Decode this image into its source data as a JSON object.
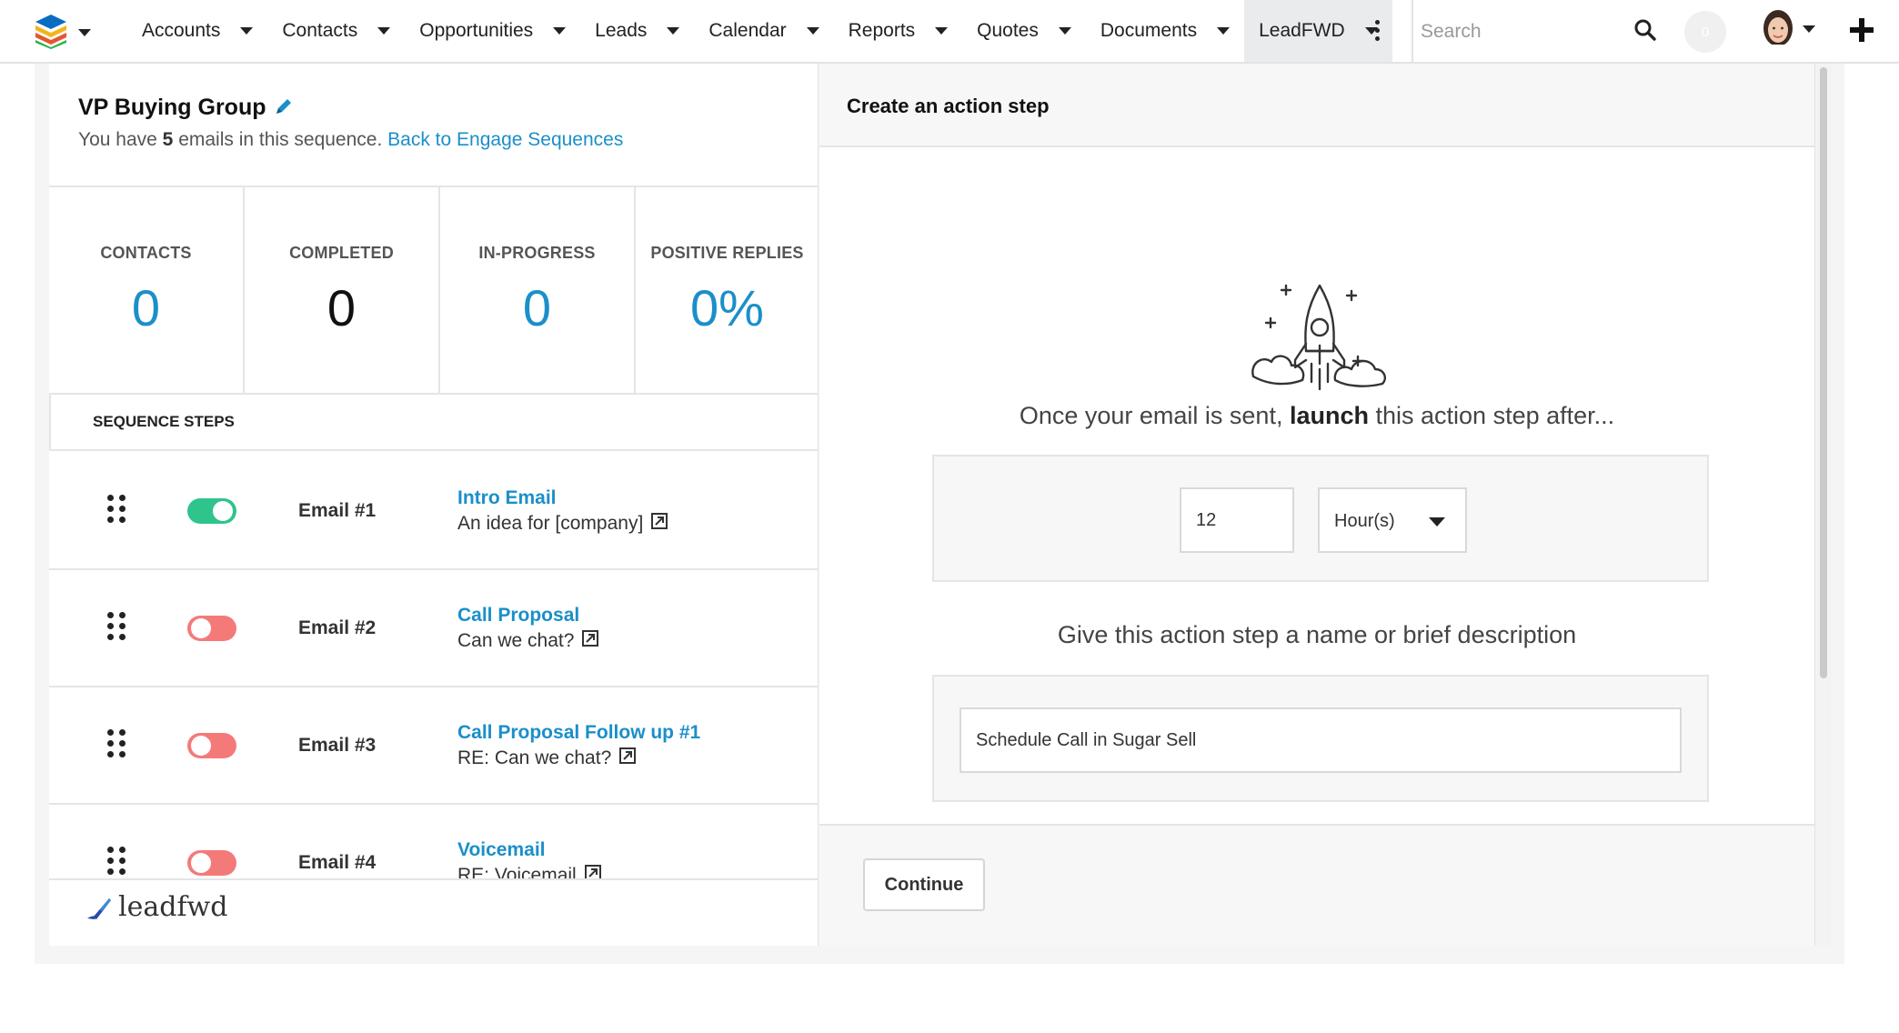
{
  "colors": {
    "accent": "#1b8fc9",
    "toggle_on": "#2ec48b",
    "toggle_off": "#f47a7a"
  },
  "nav": {
    "logo_icon": "sugar-cube-logo-icon",
    "items": [
      {
        "label": "Accounts"
      },
      {
        "label": "Contacts"
      },
      {
        "label": "Opportunities"
      },
      {
        "label": "Leads"
      },
      {
        "label": "Calendar"
      },
      {
        "label": "Reports"
      },
      {
        "label": "Quotes"
      },
      {
        "label": "Documents"
      },
      {
        "label": "LeadFWD",
        "active": true
      }
    ],
    "search_placeholder": "Search",
    "notification_count": "0"
  },
  "sequence": {
    "title": "VP Buying Group",
    "subtitle_prefix": "You have",
    "email_count": "5",
    "subtitle_suffix": "emails in this sequence.",
    "back_link": "Back to Engage Sequences"
  },
  "stats": [
    {
      "label": "CONTACTS",
      "value": "0",
      "color": "#1b8fc9"
    },
    {
      "label": "COMPLETED",
      "value": "0",
      "color": "#111111"
    },
    {
      "label": "IN-PROGRESS",
      "value": "0",
      "color": "#1b8fc9"
    },
    {
      "label": "POSITIVE REPLIES",
      "value": "0%",
      "color": "#1b8fc9"
    }
  ],
  "steps_heading": "SEQUENCE STEPS",
  "steps": [
    {
      "label": "Email #1",
      "name": "Intro Email",
      "subject": "An idea for [company]",
      "enabled": true
    },
    {
      "label": "Email #2",
      "name": "Call Proposal",
      "subject": "Can we chat?",
      "enabled": false
    },
    {
      "label": "Email #3",
      "name": "Call Proposal Follow up #1",
      "subject": "RE: Can we chat?",
      "enabled": false
    },
    {
      "label": "Email #4",
      "name": "Voicemail",
      "subject": "RE: Voicemail",
      "enabled": false
    }
  ],
  "footer": {
    "brand": "leadfwd"
  },
  "action": {
    "heading": "Create an action step",
    "launch_prefix": "Once your email is sent,",
    "launch_bold": "launch",
    "launch_suffix": "this action step after...",
    "delay_value": "12",
    "delay_unit": "Hour(s)",
    "description_prompt": "Give this action step a name or brief description",
    "description_value": "Schedule Call in Sugar Sell",
    "continue_label": "Continue"
  }
}
